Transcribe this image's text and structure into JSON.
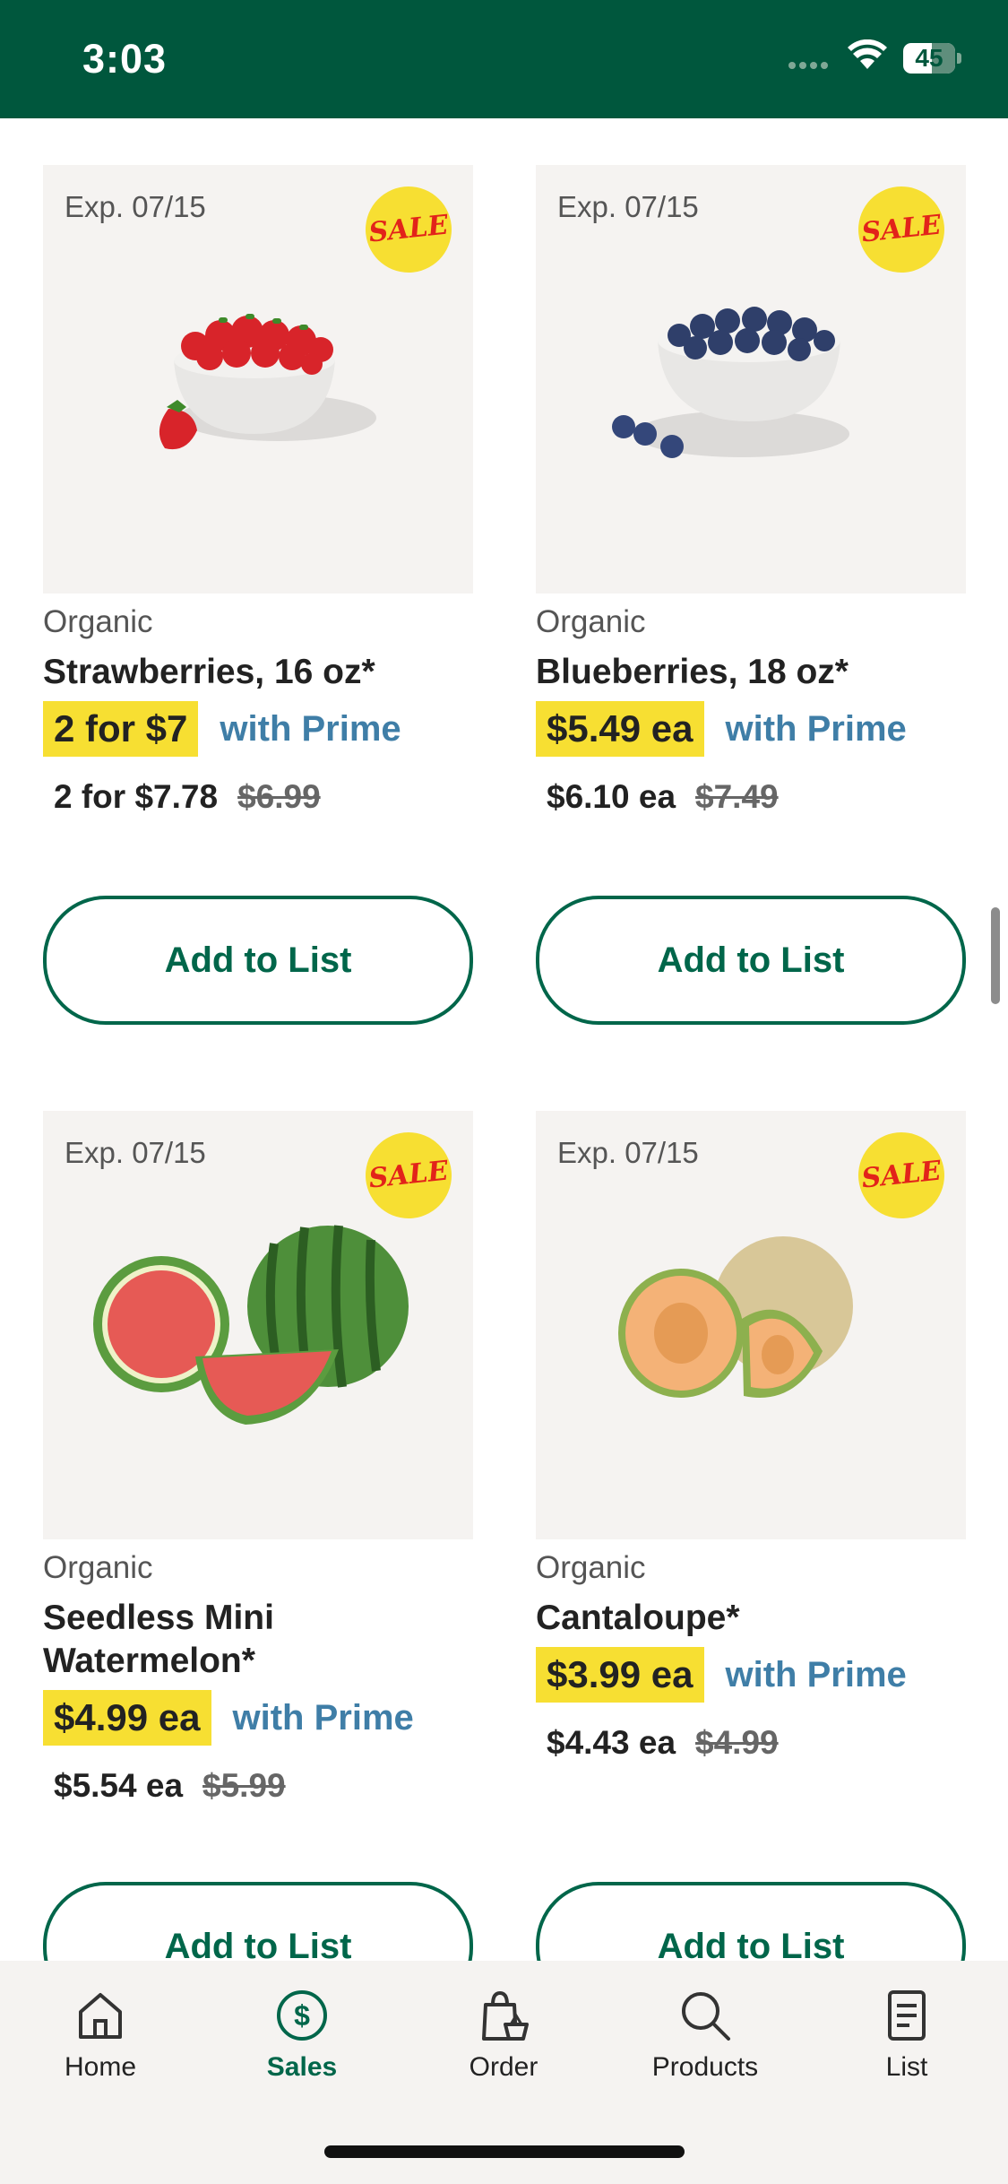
{
  "status_bar": {
    "time": "3:03",
    "battery": "45"
  },
  "products": [
    {
      "expires": "Exp. 07/15",
      "badge": "SALE",
      "category": "Organic",
      "name": "Strawberries, 16 oz*",
      "prime_price": "2 for $7",
      "prime_label": "with Prime",
      "member_price": "2 for $7.78",
      "regular_price": "$6.99",
      "button": "Add to List",
      "image": "strawberries-bowl"
    },
    {
      "expires": "Exp. 07/15",
      "badge": "SALE",
      "category": "Organic",
      "name": "Blueberries, 18 oz*",
      "prime_price": "$5.49 ea",
      "prime_label": "with Prime",
      "member_price": "$6.10 ea",
      "regular_price": "$7.49",
      "button": "Add to List",
      "image": "blueberries-bowl"
    },
    {
      "expires": "Exp. 07/15",
      "badge": "SALE",
      "category": "Organic",
      "name": "Seedless Mini Watermelon*",
      "prime_price": "$4.99 ea",
      "prime_label": "with Prime",
      "member_price": "$5.54 ea",
      "regular_price": "$5.99",
      "button": "Add to List",
      "image": "watermelon"
    },
    {
      "expires": "Exp. 07/15",
      "badge": "SALE",
      "category": "Organic",
      "name": "Cantaloupe*",
      "prime_price": "$3.99 ea",
      "prime_label": "with Prime",
      "member_price": "$4.43 ea",
      "regular_price": "$4.99",
      "button": "Add to List",
      "image": "cantaloupe"
    }
  ],
  "tabs": [
    {
      "label": "Home",
      "icon": "home-icon",
      "active": false
    },
    {
      "label": "Sales",
      "icon": "dollar-icon",
      "active": true
    },
    {
      "label": "Order",
      "icon": "shopping-bag-icon",
      "active": false
    },
    {
      "label": "Products",
      "icon": "search-icon",
      "active": false
    },
    {
      "label": "List",
      "icon": "list-icon",
      "active": false
    }
  ],
  "colors": {
    "brand_green": "#00573d",
    "accent_green": "#00664a",
    "sale_yellow": "#f7df32",
    "prime_blue": "#3f7ea7"
  }
}
